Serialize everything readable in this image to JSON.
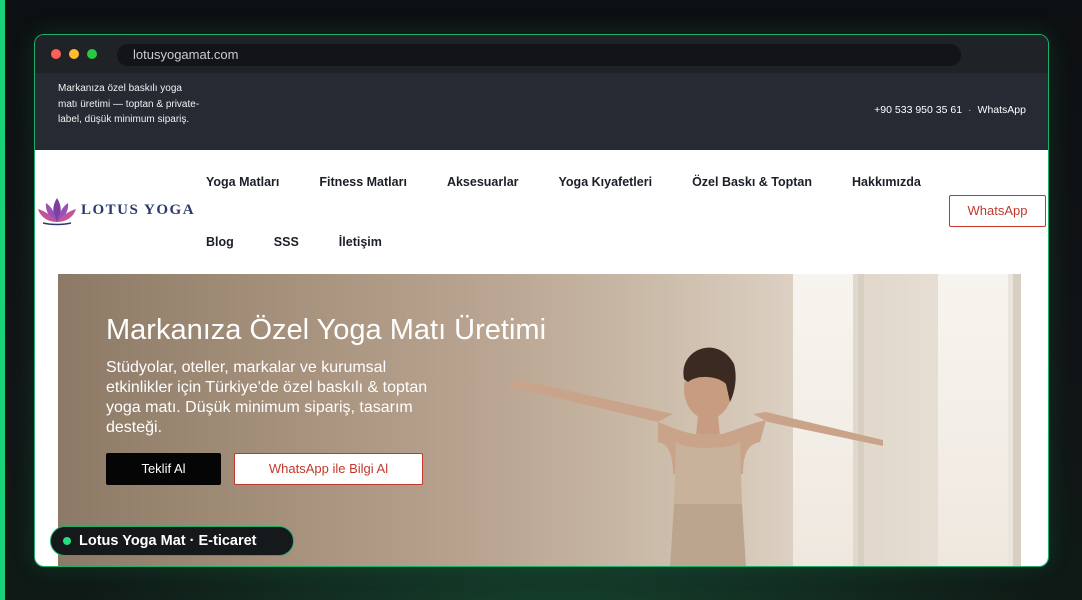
{
  "browser": {
    "url": "lotusyogamat.com"
  },
  "topbar": {
    "tagline": "Markanıza özel baskılı yoga matı üretimi — toptan & private-label, düşük minimum sipariş.",
    "phone": "+90 533 950 35 61",
    "separator": "·",
    "whatsapp": "WhatsApp"
  },
  "header": {
    "logo_text": "LOTUS YOGA",
    "nav_row1": [
      "Yoga Matları",
      "Fitness Matları",
      "Aksesuarlar",
      "Yoga Kıyafetleri",
      "Özel Baskı & Toptan",
      "Hakkımızda"
    ],
    "nav_row2": [
      "Blog",
      "SSS",
      "İletişim"
    ],
    "whatsapp_button": "WhatsApp"
  },
  "hero": {
    "title": "Markanıza Özel Yoga Matı Üretimi",
    "subtitle": "Stüdyolar, oteller, markalar ve kurumsal etkinlikler için Türkiye'de özel baskılı & toptan yoga matı. Düşük minimum sipariş, tasarım desteği.",
    "primary_button": "Teklif Al",
    "secondary_button": "WhatsApp ile Bilgi Al"
  },
  "badge": {
    "label": "Lotus Yoga Mat · E-ticaret"
  },
  "colors": {
    "accent_green": "#19d37a",
    "brand_red": "#c0392b",
    "topbar_bg": "#252a33"
  }
}
